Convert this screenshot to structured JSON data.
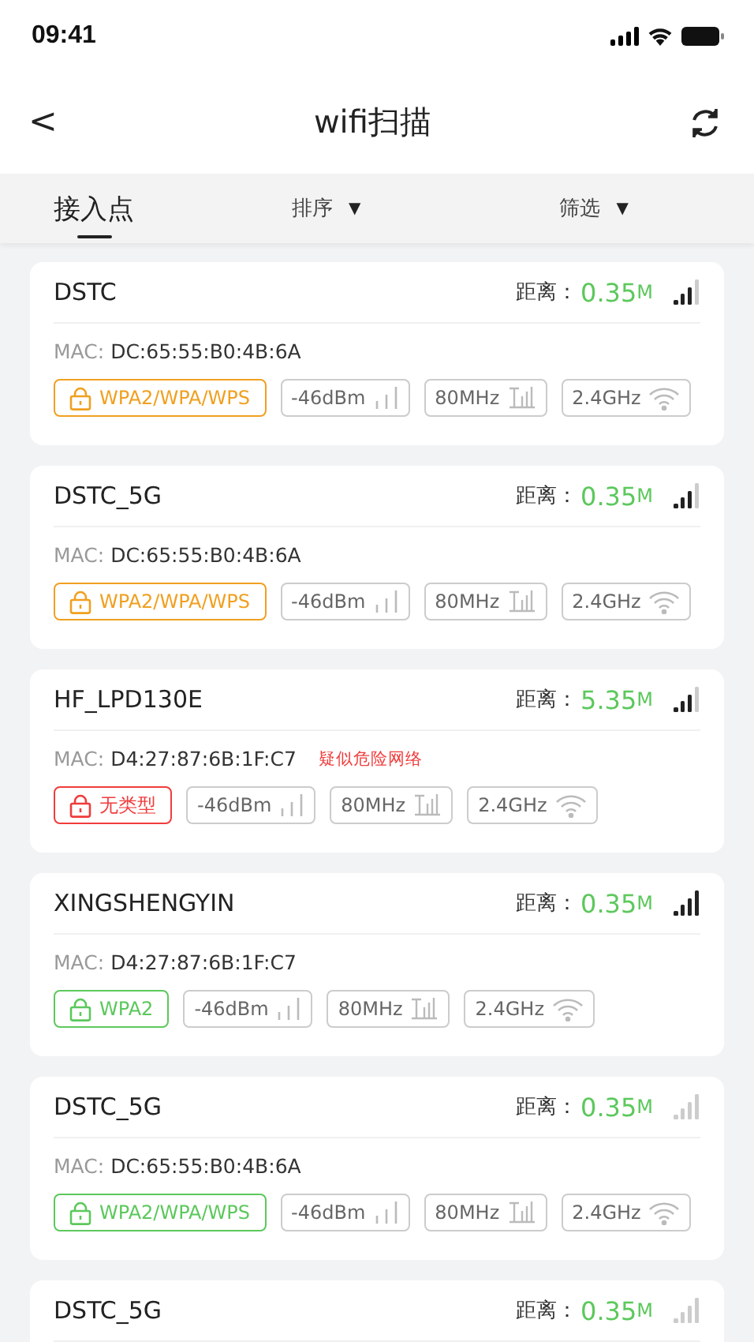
{
  "status_bar": {
    "time": "09:41"
  },
  "nav": {
    "back": "<",
    "title": "wifi扫描"
  },
  "tabs": [
    {
      "label": "接入点",
      "selected": true,
      "dropdown": false
    },
    {
      "label": "排序",
      "selected": false,
      "dropdown": true
    },
    {
      "label": "筛选",
      "selected": false,
      "dropdown": true
    }
  ],
  "dropdown_mark": "▼",
  "access_points": [
    {
      "name": "DSTC",
      "distance_label": "距离：",
      "distance": "0.35",
      "unit": "M",
      "level": 0.75,
      "mac_label": "MAC:",
      "mac": "DC:65:55:B0:4B:6A",
      "security": {
        "label": "WPA2/WPA/WPS",
        "color": "#f0a020"
      },
      "rssi": "-46dBm",
      "bandwidth": "80MHz",
      "band": "2.4GHz"
    },
    {
      "name": "DSTC_5G",
      "distance_label": "距离：",
      "distance": "0.35",
      "unit": "M",
      "level": 0.75,
      "mac_label": "MAC:",
      "mac": "DC:65:55:B0:4B:6A",
      "security": {
        "label": "WPA2/WPA/WPS",
        "color": "#f0a020"
      },
      "rssi": "-46dBm",
      "bandwidth": "80MHz",
      "band": "2.4GHz"
    },
    {
      "name": "HF_LPD130E",
      "distance_label": "距离：",
      "distance": "5.35",
      "unit": "M",
      "level": 0.75,
      "mac_label": "MAC:",
      "mac": "D4:27:87:6B:1F:C7",
      "warning": "疑似危险网络",
      "security": {
        "label": "无类型",
        "color": "#f03c3c"
      },
      "rssi": "-46dBm",
      "bandwidth": "80MHz",
      "band": "2.4GHz"
    },
    {
      "name": "XINGSHENGYIN",
      "distance_label": "距离：",
      "distance": "0.35",
      "unit": "M",
      "level": 1,
      "mac_label": "MAC:",
      "mac": "D4:27:87:6B:1F:C7",
      "security": {
        "label": "WPA2",
        "color": "#5cc85c"
      },
      "rssi": "-46dBm",
      "bandwidth": "80MHz",
      "band": "2.4GHz"
    },
    {
      "name": "DSTC_5G",
      "distance_label": "距离：",
      "distance": "0.35",
      "unit": "M",
      "level": 0,
      "mac_label": "MAC:",
      "mac": "DC:65:55:B0:4B:6A",
      "security": {
        "label": "WPA2/WPA/WPS",
        "color": "#5cc85c"
      },
      "rssi": "-46dBm",
      "bandwidth": "80MHz",
      "band": "2.4GHz"
    },
    {
      "name": "DSTC_5G",
      "distance_label": "距离：",
      "distance": "0.35",
      "unit": "M",
      "level": 0
    }
  ]
}
